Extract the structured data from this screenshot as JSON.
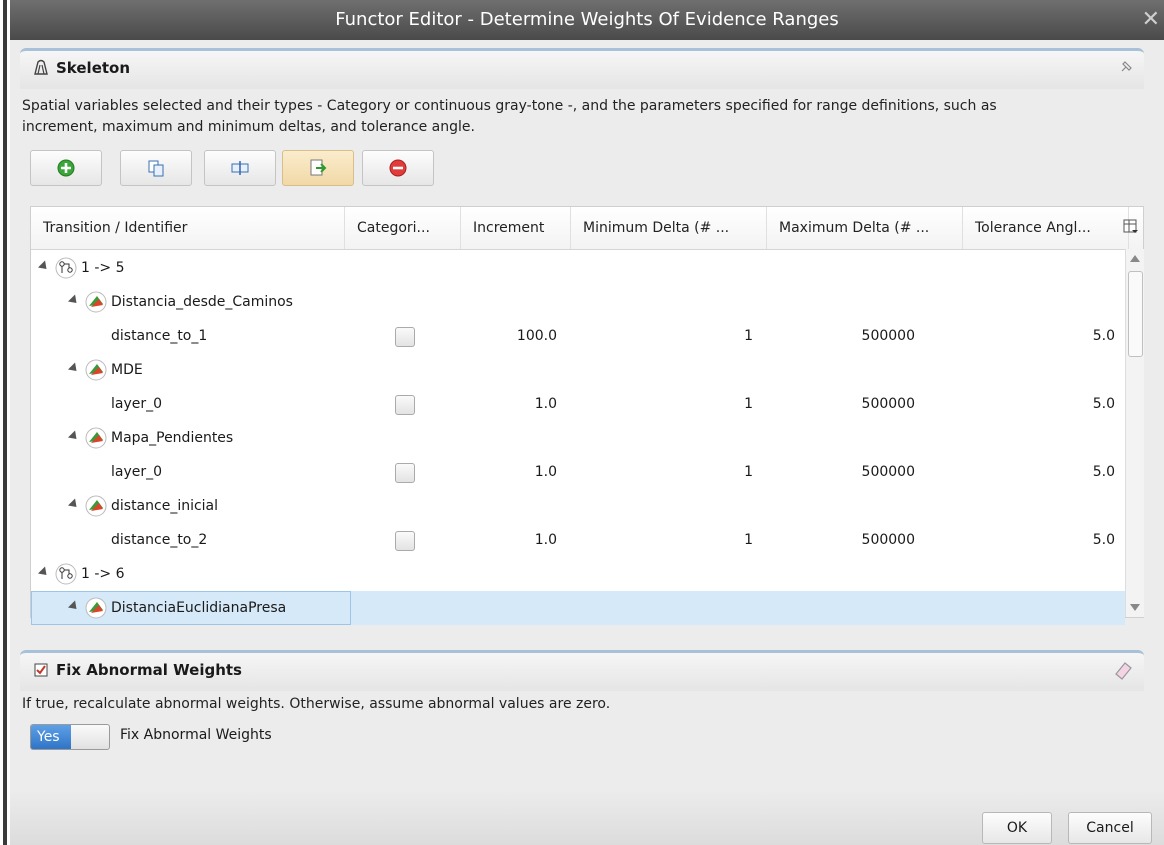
{
  "window": {
    "title": "Functor Editor - Determine Weights Of Evidence Ranges",
    "close_glyph": "✕"
  },
  "skeleton": {
    "title": "Skeleton",
    "description_line1": "Spatial variables selected and their types - Category or continuous gray-tone -, and the parameters specified for range definitions, such as",
    "description_line2": "increment, maximum and minimum deltas, and tolerance angle."
  },
  "toolbar": {
    "buttons": [
      {
        "icon": "add-icon"
      },
      {
        "icon": "copy-icon"
      },
      {
        "icon": "edit-icon"
      },
      {
        "icon": "export-icon"
      },
      {
        "icon": "remove-icon"
      }
    ]
  },
  "table": {
    "columns": [
      "Transition / Identifier",
      "Categori...",
      "Increment",
      "Minimum Delta (# ...",
      "Maximum Delta (# ...",
      "Tolerance Angl..."
    ],
    "rows": [
      {
        "type": "transition",
        "label": "1 -> 5"
      },
      {
        "type": "variable",
        "label": "Distancia_desde_Caminos"
      },
      {
        "type": "layer",
        "label": "distance_to_1",
        "increment": "100.0",
        "min_delta": "1",
        "max_delta": "500000",
        "tolerance": "5.0"
      },
      {
        "type": "variable",
        "label": "MDE"
      },
      {
        "type": "layer",
        "label": "layer_0",
        "increment": "1.0",
        "min_delta": "1",
        "max_delta": "500000",
        "tolerance": "5.0"
      },
      {
        "type": "variable",
        "label": "Mapa_Pendientes"
      },
      {
        "type": "layer",
        "label": "layer_0",
        "increment": "1.0",
        "min_delta": "1",
        "max_delta": "500000",
        "tolerance": "5.0"
      },
      {
        "type": "variable",
        "label": "distance_inicial"
      },
      {
        "type": "layer",
        "label": "distance_to_2",
        "increment": "1.0",
        "min_delta": "1",
        "max_delta": "500000",
        "tolerance": "5.0"
      },
      {
        "type": "transition",
        "label": "1 -> 6"
      },
      {
        "type": "variable",
        "label": "DistanciaEuclidianaPresa",
        "selected": true
      }
    ]
  },
  "fix_abnormal": {
    "title": "Fix Abnormal Weights",
    "description": "If true, recalculate abnormal weights. Otherwise, assume abnormal values are zero.",
    "toggle_value": "Yes",
    "toggle_label": "Fix Abnormal Weights"
  },
  "footer": {
    "ok_label": "OK",
    "cancel_label": "Cancel"
  },
  "colors": {
    "accent": "#2f74c7",
    "selection": "#d6e9f8",
    "header_border": "#a8c0d8"
  }
}
